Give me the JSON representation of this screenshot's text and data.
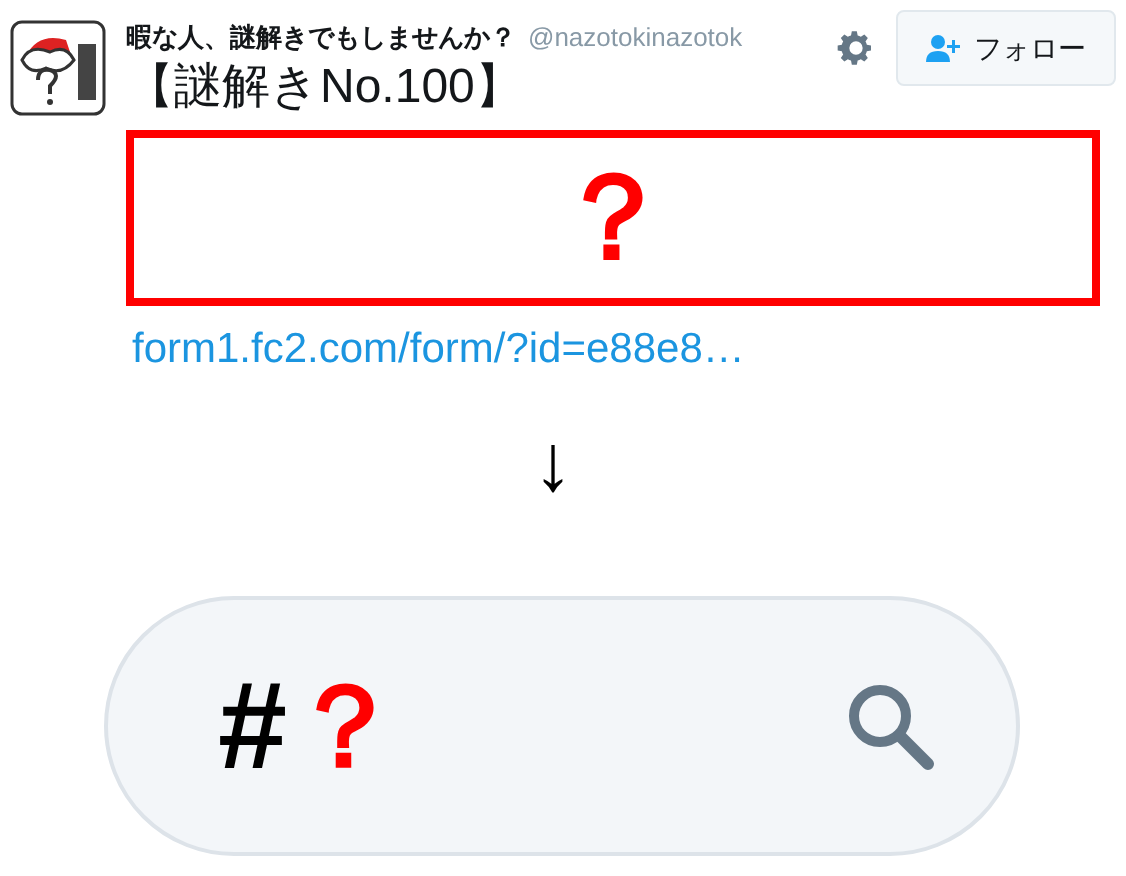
{
  "tweet_header": {
    "display_name": "暇な人、謎解きでもしませんか？",
    "handle": "@nazotokinazotok",
    "follow_button": "フォロー"
  },
  "title": "【謎解きNo.100】",
  "answer_box": {
    "text": "？"
  },
  "link": "form1.fc2.com/form/?id=e88e8…",
  "arrow": "↓",
  "search_bar": {
    "hash": "#",
    "mark": "？"
  }
}
